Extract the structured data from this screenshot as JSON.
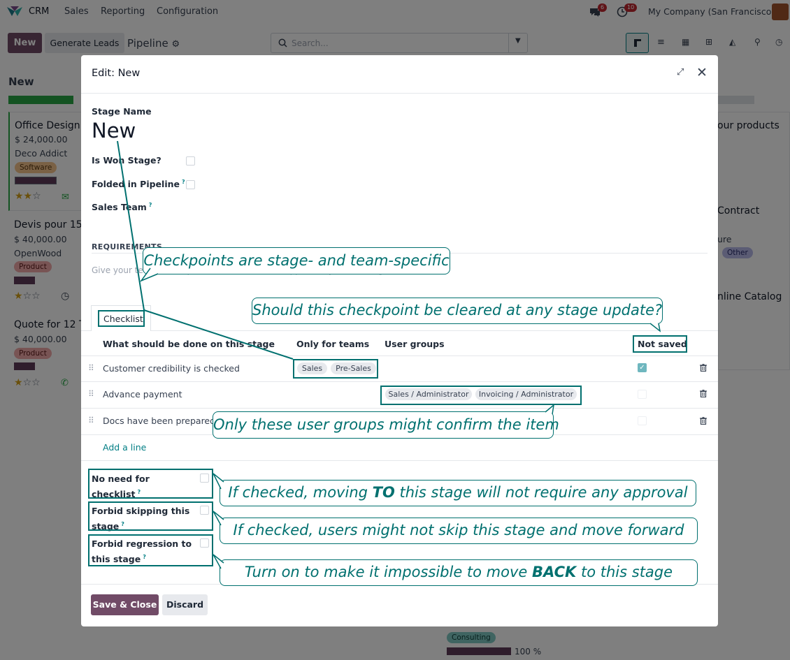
{
  "topbar": {
    "app": "CRM",
    "menu": [
      "Sales",
      "Reporting",
      "Configuration"
    ],
    "chat_badge": "6",
    "activity_badge": "10",
    "company": "My Company (San Francisco)"
  },
  "control": {
    "new_label": "New",
    "generate_label": "Generate Leads",
    "pipeline_label": "Pipeline",
    "search_placeholder": "Search..."
  },
  "kanban": {
    "column_title": "New",
    "cards": [
      {
        "title": "Office Design",
        "amount": "$ 24,000.00",
        "company": "Deco Addict",
        "tag": "Software"
      },
      {
        "title": "Devis pour 150",
        "amount": "$ 40,000.00",
        "company": "OpenWood",
        "tag": "Product"
      },
      {
        "title": "Quote for 12 T",
        "amount": "$ 40,000.00",
        "tag": "Product"
      }
    ],
    "right_cards": [
      {
        "title": "our products"
      },
      {
        "title": "Contract",
        "line2": "ure",
        "tag": "Other"
      },
      {
        "title": "nline Catalog"
      }
    ],
    "bottom_tag": "Consulting",
    "bottom_progress": "100 %"
  },
  "dialog": {
    "title": "Edit: New",
    "stage_name_label": "Stage Name",
    "stage_name_value": "New",
    "is_won_label": "Is Won Stage?",
    "folded_label": "Folded in Pipeline",
    "sales_team_label": "Sales Team",
    "requirements_label": "REQUIREMENTS",
    "requirements_placeholder": "Give your team the requirements to move an opportunity to this stage.",
    "tab_label": "Checklist",
    "columns": [
      "What should be done on this stage",
      "Only for teams",
      "User groups",
      "Not saved"
    ],
    "rows": [
      {
        "title": "Customer credibility is checked",
        "teams": [
          "Sales",
          "Pre-Sales"
        ],
        "groups": [],
        "checked": true
      },
      {
        "title": "Advance payment",
        "teams": [],
        "groups": [
          "Sales / Administrator",
          "Invoicing / Administrator"
        ],
        "checked": false
      },
      {
        "title": "Docs have been prepared",
        "teams": [],
        "groups": [],
        "checked": false
      }
    ],
    "add_line": "Add a line",
    "no_need_label_1": "No need for",
    "no_need_label_2": "checklist",
    "forbid_skip_label_1": "Forbid skipping this",
    "forbid_skip_label_2": "stage",
    "forbid_regress_label_1": "Forbid regression to",
    "forbid_regress_label_2": "this stage",
    "save_label": "Save & Close",
    "discard_label": "Discard"
  },
  "callouts": {
    "checkpoints": "Checkpoints are stage- and team-specific",
    "cleared": "Should this checkpoint be cleared at any stage update?",
    "groups": "Only these user groups might confirm the item",
    "no_need_pre": "If checked, moving ",
    "no_need_bold": "TO",
    "no_need_post": " this stage will not require any approval",
    "skip": "If checked, users might not skip this stage and move forward",
    "regress_pre": "Turn on to make it impossible to move ",
    "regress_bold": "BACK",
    "regress_post": " to this stage"
  },
  "colors": {
    "brand": "#714b67",
    "accent": "#017e84",
    "annotation": "#00706f"
  }
}
